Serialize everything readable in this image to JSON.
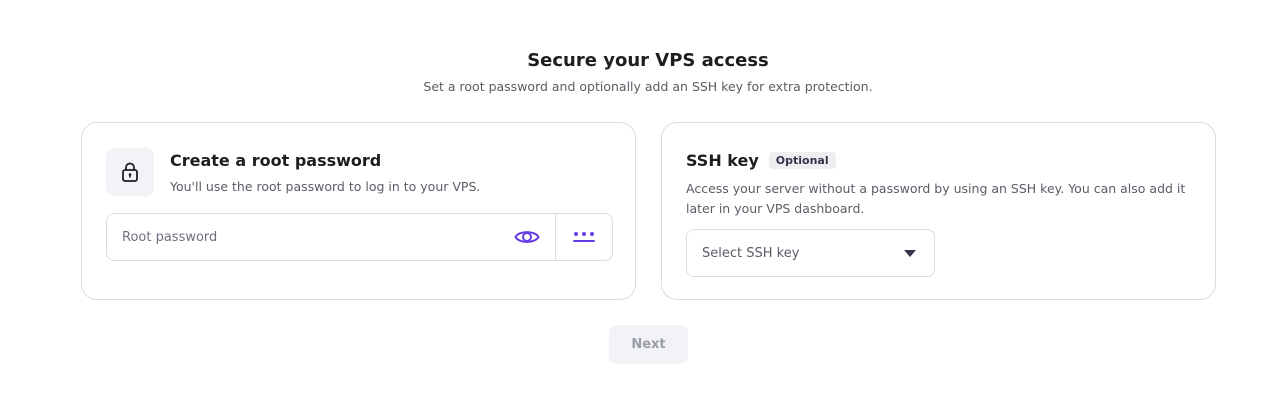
{
  "header": {
    "title": "Secure your VPS access",
    "subtitle": "Set a root password and optionally add an SSH key for extra protection."
  },
  "password_card": {
    "icon": "lock-icon",
    "title": "Create a root password",
    "description": "You'll use the root password to log in to your VPS.",
    "input_placeholder": "Root password",
    "input_value": "",
    "show_icon": "eye-icon",
    "generate_icon": "dots-icon"
  },
  "ssh_card": {
    "title": "SSH key",
    "badge": "Optional",
    "description": "Access your server without a password by using an SSH key. You can also add it later in your VPS dashboard.",
    "select_label": "Select SSH key",
    "select_icon": "caret-down-icon"
  },
  "footer": {
    "next_label": "Next"
  },
  "colors": {
    "accent": "#673de6",
    "text_primary": "#1d1e20",
    "text_secondary": "#5a5d66",
    "border": "#dadce0",
    "disabled_bg": "#f2f3f6",
    "disabled_text": "#9a9ca8"
  }
}
